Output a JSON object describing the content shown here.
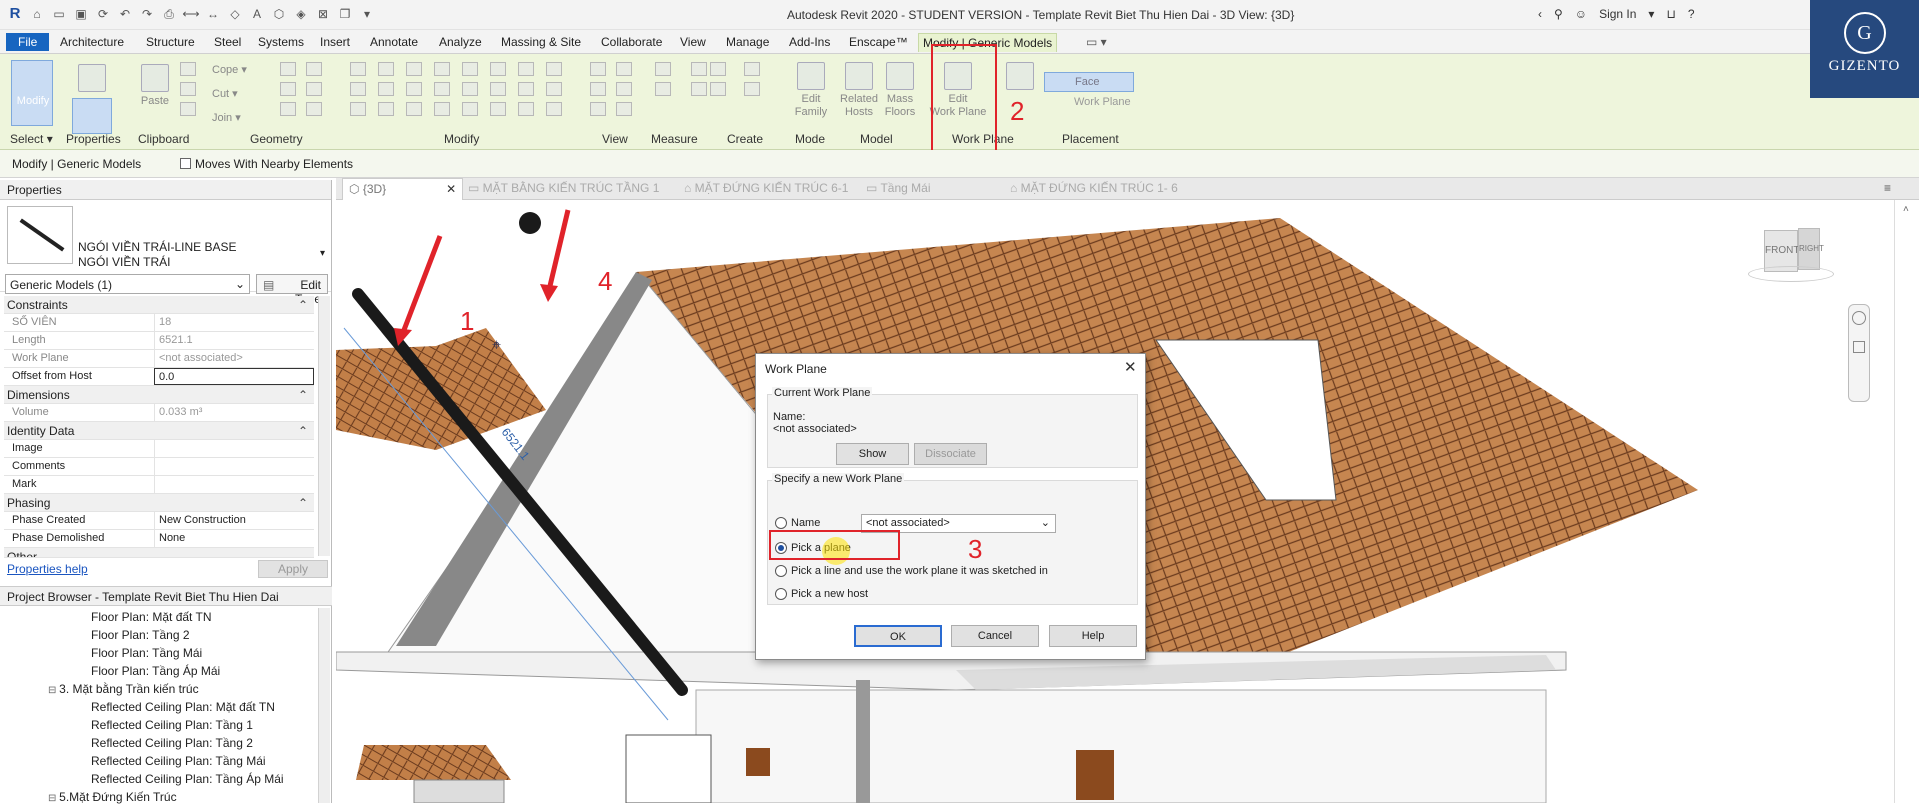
{
  "window": {
    "title": "Autodesk Revit 2020 - STUDENT VERSION - Template Revit Biet Thu Hien Dai - 3D View: {3D}",
    "sign_in": "Sign In"
  },
  "menu": [
    "File",
    "Architecture",
    "Structure",
    "Steel",
    "Systems",
    "Insert",
    "Annotate",
    "Analyze",
    "Massing & Site",
    "Collaborate",
    "View",
    "Manage",
    "Add-Ins",
    "Enscape™",
    "Modify | Generic Models"
  ],
  "ribbon": {
    "modify": "Modify",
    "paste": "Paste",
    "cope": "Cope",
    "cut": "Cut",
    "join": "Join",
    "edit_family": [
      "Edit",
      "Family"
    ],
    "related_hosts": [
      "Related",
      "Hosts"
    ],
    "mass_floors": [
      "Mass",
      "Floors"
    ],
    "edit_work_plane": [
      "Edit",
      "Work Plane"
    ],
    "face": "Face",
    "work_plane": "Work Plane",
    "groups": {
      "select": "Select",
      "properties": "Properties",
      "clipboard": "Clipboard",
      "geometry": "Geometry",
      "modify": "Modify",
      "view": "View",
      "measure": "Measure",
      "create": "Create",
      "mode": "Mode",
      "model": "Model",
      "work_plane": "Work Plane",
      "placement": "Placement"
    }
  },
  "options_bar": {
    "context": "Modify | Generic Models",
    "moves_with": "Moves With Nearby Elements"
  },
  "properties": {
    "header": "Properties",
    "type_line1": "NGÓI VIỀN TRÁI-LINE BASE",
    "type_line2": "NGÓI VIỀN TRÁI",
    "instance": "Generic Models (1)",
    "edit_type": "Edit Type",
    "sections": {
      "constraints": "Constraints",
      "dimensions": "Dimensions",
      "identity": "Identity Data",
      "phasing": "Phasing",
      "other": "Other"
    },
    "rows": {
      "so_vien": [
        "SỐ VIÊN",
        "18"
      ],
      "length": [
        "Length",
        "6521.1"
      ],
      "work_plane": [
        "Work Plane",
        "<not associated>"
      ],
      "offset": [
        "Offset from Host",
        "0.0"
      ],
      "volume": [
        "Volume",
        "0.033 m³"
      ],
      "image": [
        "Image",
        ""
      ],
      "comments": [
        "Comments",
        ""
      ],
      "mark": [
        "Mark",
        ""
      ],
      "phase_created": [
        "Phase Created",
        "New Construction"
      ],
      "phase_demolished": [
        "Phase Demolished",
        "None"
      ]
    },
    "help": "Properties help",
    "apply": "Apply"
  },
  "project_browser": {
    "header": "Project Browser - Template Revit Biet Thu Hien Dai",
    "items": [
      "Floor Plan: Mặt đất TN",
      "Floor Plan: Tầng 2",
      "Floor Plan: Tầng Mái",
      "Floor Plan: Tầng Áp Mái",
      "3. Mặt bằng Trần kiến trúc",
      "Reflected Ceiling Plan: Mặt đất TN",
      "Reflected Ceiling Plan: Tầng 1",
      "Reflected Ceiling Plan: Tầng 2",
      "Reflected Ceiling Plan: Tầng Mái",
      "Reflected Ceiling Plan: Tầng Áp Mái",
      "5.Mặt Đứng Kiến Trúc"
    ]
  },
  "view_tabs": [
    "{3D}",
    "MẶT BẰNG KIẾN TRÚC TẦNG 1",
    "MẶT ĐỨNG KIẾN TRÚC 6-1",
    "Tầng Mái",
    "MẶT ĐỨNG KIẾN TRÚC 1- 6"
  ],
  "viewcube": {
    "front": "FRONT",
    "right": "RIGHT"
  },
  "dimension_label": "6521.1",
  "logo": {
    "mark": "G",
    "text": "GIZENTO"
  },
  "dialog": {
    "title": "Work Plane",
    "current_group": "Current Work Plane",
    "name_label": "Name:",
    "name_value": "<not associated>",
    "show": "Show",
    "dissociate": "Dissociate",
    "specify_group": "Specify a new Work Plane",
    "opt_name": "Name",
    "select_value": "<not associated>",
    "opt_pick_plane": "Pick a plane",
    "opt_pick_line": "Pick a line and use the work plane it was sketched in",
    "opt_pick_host": "Pick a new host",
    "ok": "OK",
    "cancel": "Cancel",
    "help": "Help"
  },
  "annotations": [
    "1",
    "2",
    "3",
    "4"
  ],
  "colors": {
    "accent": "#1765c0",
    "highlight": "#e0232a",
    "ribbon": "#eef5dc",
    "roof": "#c8804a"
  }
}
